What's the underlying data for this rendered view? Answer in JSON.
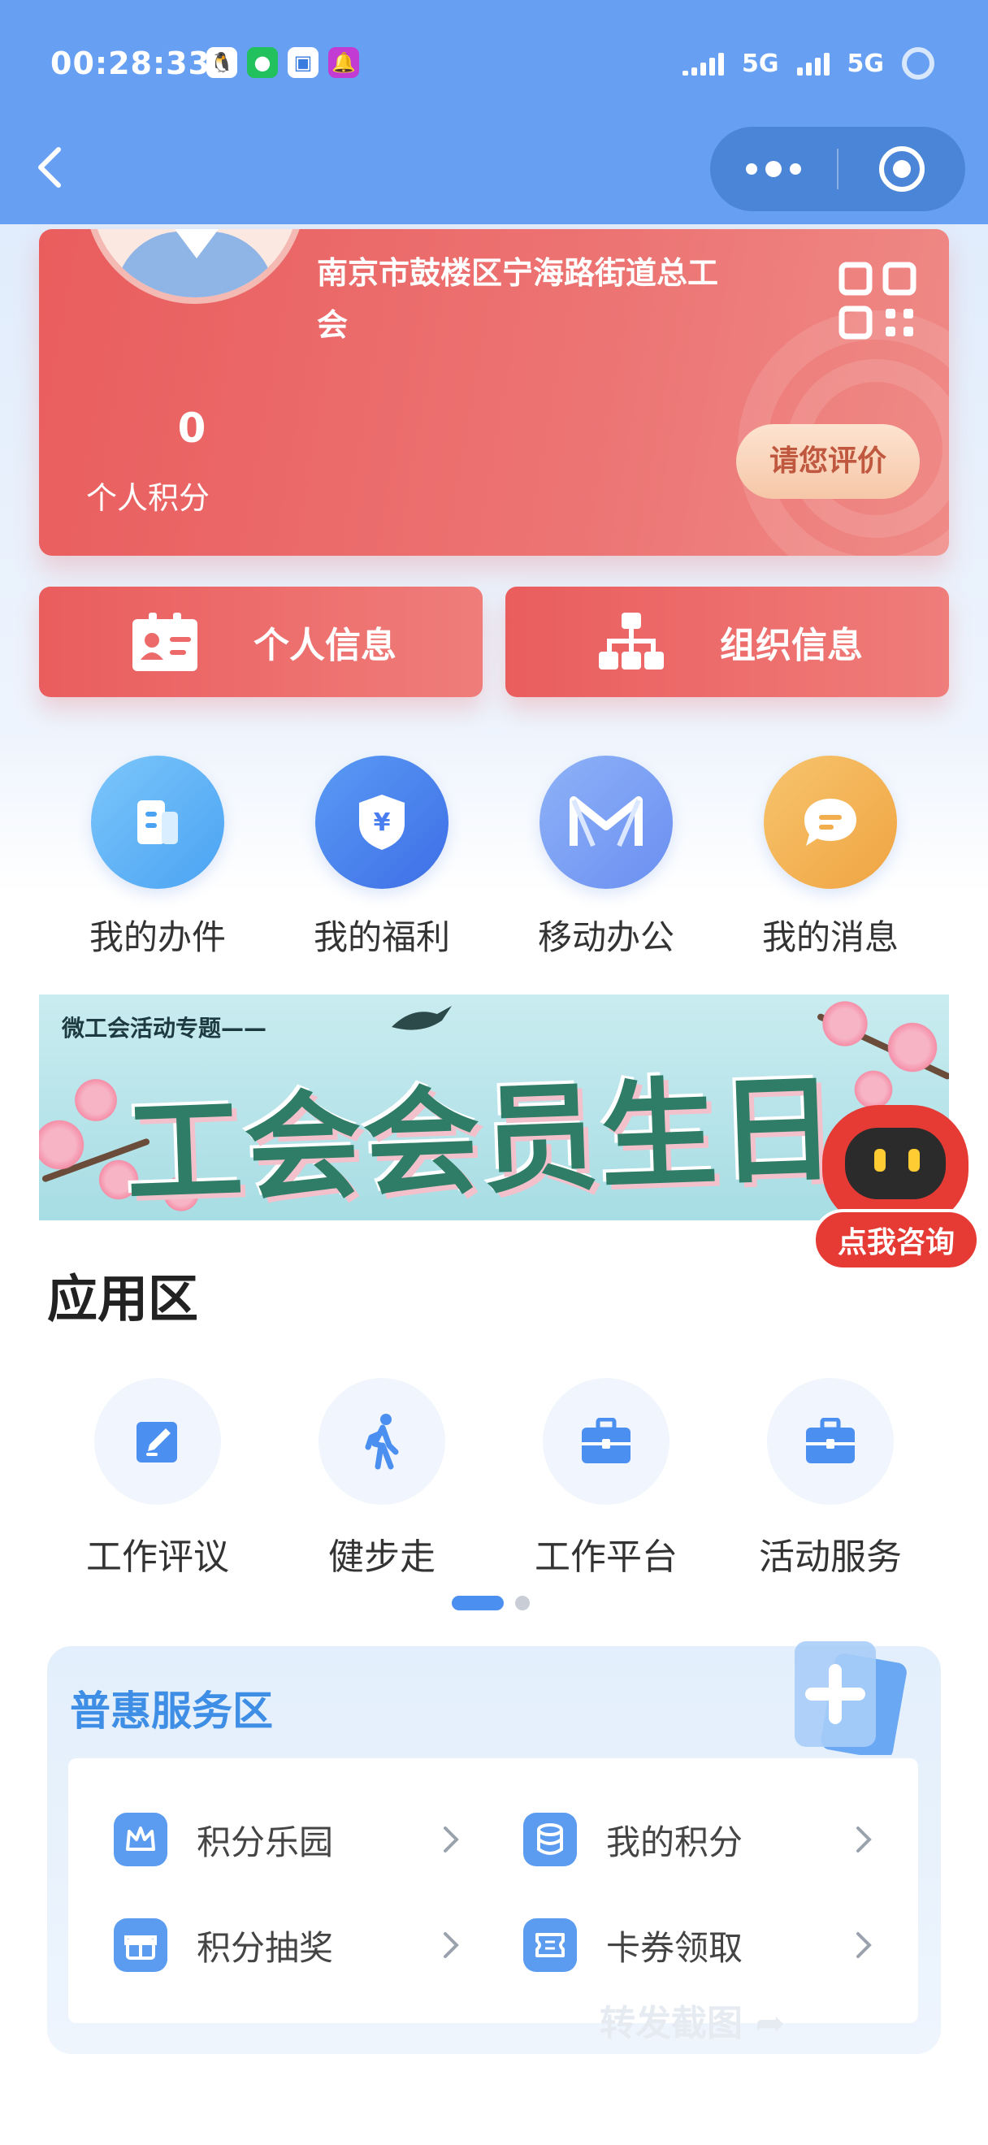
{
  "status_bar": {
    "time": "00:28:33",
    "signal1": "5G",
    "signal2": "5G"
  },
  "profile": {
    "org_name": "南京市鼓楼区宁海路街道总工会",
    "points_value": "0",
    "points_label": "个人积分",
    "rate_button": "请您评价"
  },
  "info_buttons": {
    "personal": "个人信息",
    "organization": "组织信息"
  },
  "quick_actions": [
    {
      "label": "我的办件",
      "icon": "document-icon",
      "color": "#5cb0f5"
    },
    {
      "label": "我的福利",
      "icon": "yuan-icon",
      "color": "#4b84ee"
    },
    {
      "label": "移动办公",
      "icon": "m-logo-icon",
      "color": "#7da2f4"
    },
    {
      "label": "我的消息",
      "icon": "message-icon",
      "color": "#f5b65a"
    }
  ],
  "banner": {
    "subtitle": "微工会活动专题——",
    "title": "工会会员生日月"
  },
  "assistant": {
    "label": "点我咨询"
  },
  "app_area": {
    "title": "应用区",
    "apps": [
      {
        "label": "工作评议",
        "icon": "edit-icon"
      },
      {
        "label": "健步走",
        "icon": "walking-icon"
      },
      {
        "label": "工作平台",
        "icon": "briefcase-icon"
      },
      {
        "label": "活动服务",
        "icon": "briefcase-icon"
      }
    ],
    "pager": {
      "pages": 2,
      "active": 1
    }
  },
  "benefit_area": {
    "title": "普惠服务区",
    "items": [
      {
        "label": "积分乐园",
        "icon": "crown-icon"
      },
      {
        "label": "我的积分",
        "icon": "coins-icon"
      },
      {
        "label": "积分抽奖",
        "icon": "gift-icon"
      },
      {
        "label": "卡券领取",
        "icon": "ticket-icon"
      }
    ]
  },
  "watermark": "转发截图",
  "colors": {
    "header_blue": "#67a0f3",
    "card_red": "#ea5d5e",
    "accent_blue": "#3e8ee6"
  }
}
